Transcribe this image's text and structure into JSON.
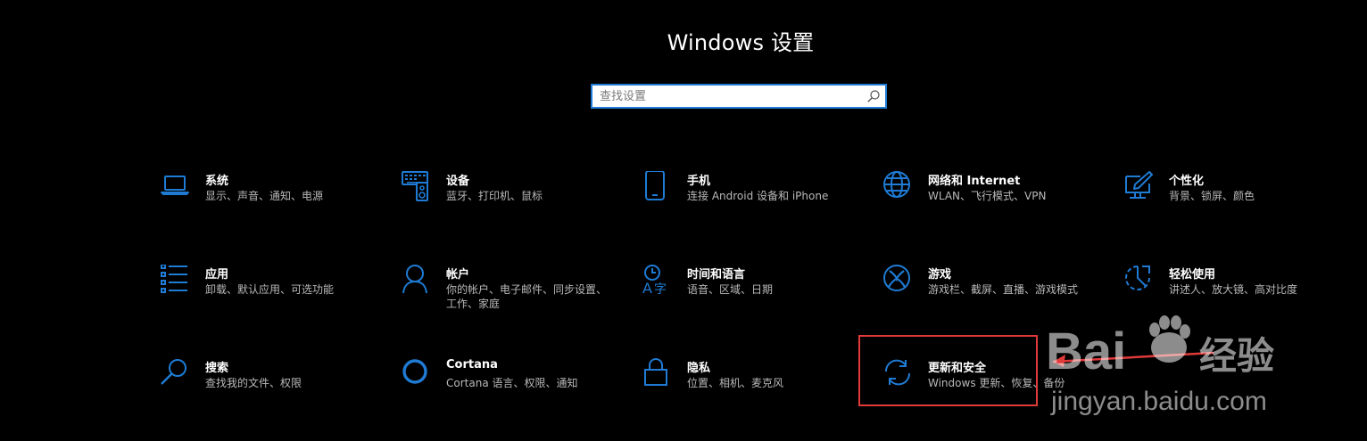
{
  "title": "Windows 设置",
  "search": {
    "placeholder": "查找设置",
    "value": ""
  },
  "accent_color": "#1f7bd4",
  "tiles": [
    {
      "name": "系统",
      "desc": "显示、声音、通知、电源",
      "icon": "laptop-icon"
    },
    {
      "name": "设备",
      "desc": "蓝牙、打印机、鼠标",
      "icon": "keyboard-speaker-icon"
    },
    {
      "name": "手机",
      "desc": "连接 Android 设备和 iPhone",
      "icon": "phone-icon"
    },
    {
      "name": "网络和 Internet",
      "desc": "WLAN、飞行模式、VPN",
      "icon": "globe-icon"
    },
    {
      "name": "个性化",
      "desc": "背景、锁屏、颜色",
      "icon": "paint-display-icon"
    },
    {
      "name": "应用",
      "desc": "卸载、默认应用、可选功能",
      "icon": "apps-list-icon"
    },
    {
      "name": "帐户",
      "desc": "你的帐户、电子邮件、同步设置、工作、家庭",
      "icon": "person-icon"
    },
    {
      "name": "时间和语言",
      "desc": "语音、区域、日期",
      "icon": "time-language-icon"
    },
    {
      "name": "游戏",
      "desc": "游戏栏、截屏、直播、游戏模式",
      "icon": "xbox-icon"
    },
    {
      "name": "轻松使用",
      "desc": "讲述人、放大镜、高对比度",
      "icon": "ease-of-access-icon"
    },
    {
      "name": "搜索",
      "desc": "查找我的文件、权限",
      "icon": "magnifier-icon"
    },
    {
      "name": "Cortana",
      "desc": "Cortana 语言、权限、通知",
      "icon": "cortana-circle-icon"
    },
    {
      "name": "隐私",
      "desc": "位置、相机、麦克风",
      "icon": "lock-icon"
    },
    {
      "name": "更新和安全",
      "desc": "Windows 更新、恢复、备份",
      "icon": "refresh-icon"
    }
  ],
  "highlight_color": "#e03a3a",
  "watermark": {
    "brand": "Baidu经验",
    "url": "jingyan.baidu.com"
  }
}
